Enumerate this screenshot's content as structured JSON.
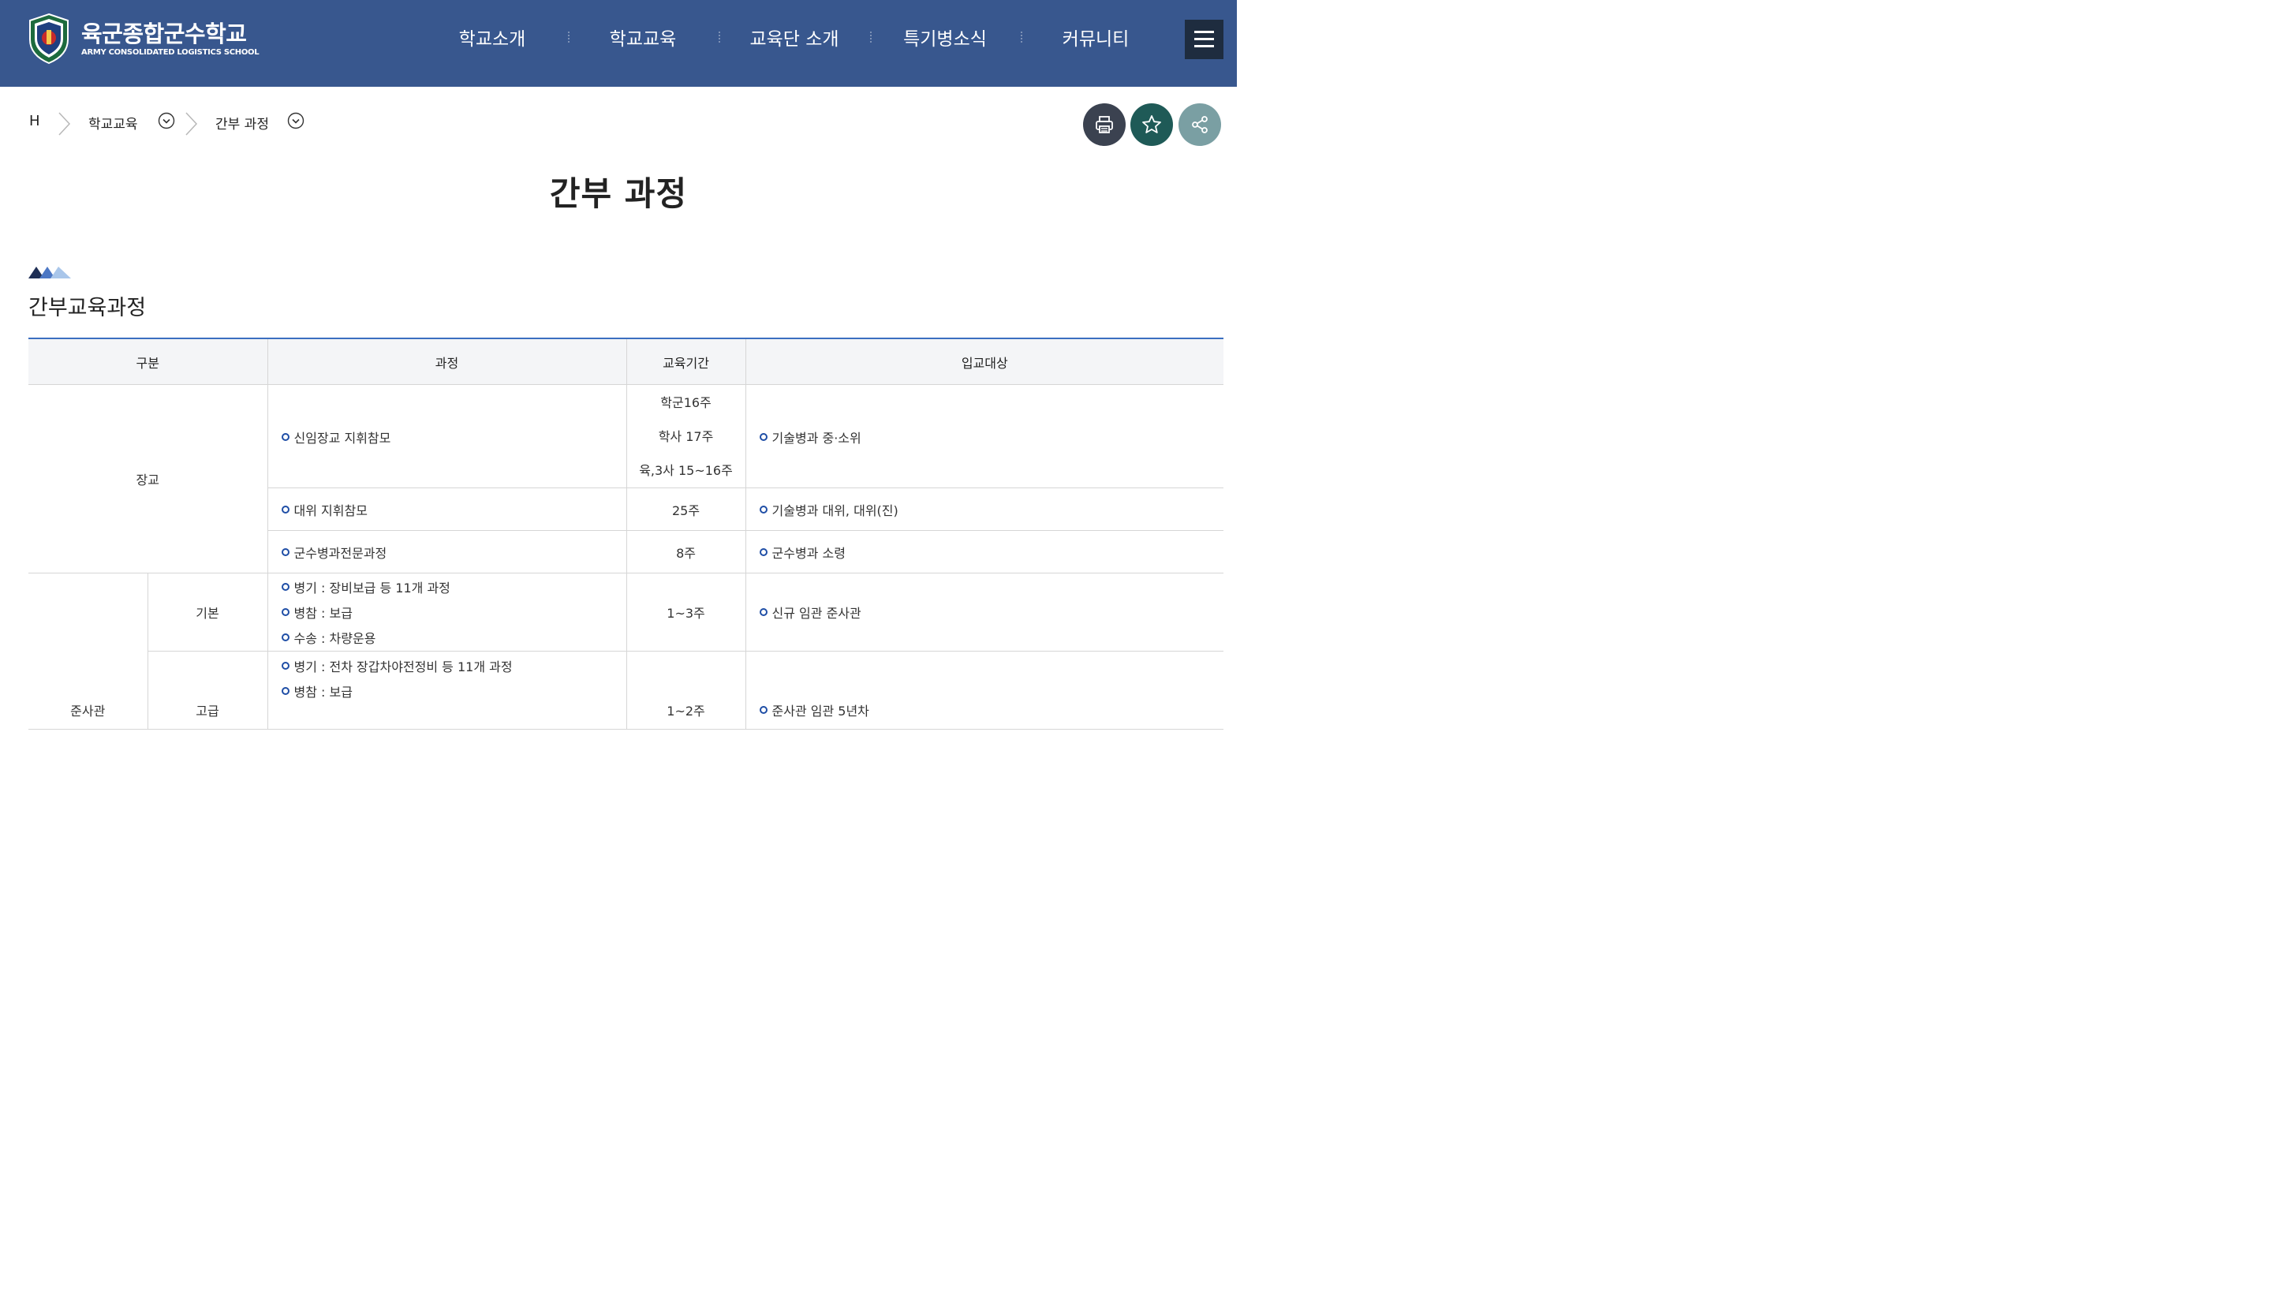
{
  "header": {
    "logo_kor": "육군종합군수학교",
    "logo_eng": "ARMY CONSOLIDATED LOGISTICS SCHOOL",
    "nav": [
      "학교소개",
      "학교교육",
      "교육단 소개",
      "특기병소식",
      "커뮤니티"
    ],
    "menu_icon": "hamburger-menu-icon",
    "brand_color": "#38578e"
  },
  "breadcrumb": {
    "home": "H",
    "level1": "학교교육",
    "level2": "간부 과정"
  },
  "actions": {
    "print_icon": "printer-icon",
    "favorite_icon": "star-icon",
    "share_icon": "share-icon",
    "colors": [
      "#3b4250",
      "#1f5a57",
      "#7a9fa3"
    ]
  },
  "page": {
    "title": "간부 과정",
    "section_title": "간부교육과정"
  },
  "table": {
    "headers": [
      "구분",
      "과정",
      "교육기간",
      "입교대상"
    ],
    "rows": {
      "janggyo": {
        "category": "장교",
        "r1": {
          "course": "신임장교 지휘참모",
          "period": [
            "학군16주",
            "학사 17주",
            "육,3사 15~16주"
          ],
          "target": "기술병과 중·소위"
        },
        "r2": {
          "course": "대위 지휘참모",
          "period": "25주",
          "target": "기술병과 대위, 대위(진)"
        },
        "r3": {
          "course": "군수병과전문과정",
          "period": "8주",
          "target": "군수병과 소령"
        }
      },
      "junsagwan": {
        "category": "준사관",
        "basic": {
          "sub": "기본",
          "courses": [
            "병기 : 장비보급 등 11개 과정",
            "병참 : 보급",
            "수송 : 차량운용"
          ],
          "period": "1~3주",
          "target": "신규 임관 준사관"
        },
        "advanced": {
          "sub": "고급",
          "courses": [
            "병기 : 전차 장갑차야전정비 등 11개 과정",
            "병참 : 보급"
          ],
          "period": "1~2주",
          "target": "준사관 임관 5년차"
        }
      }
    }
  }
}
